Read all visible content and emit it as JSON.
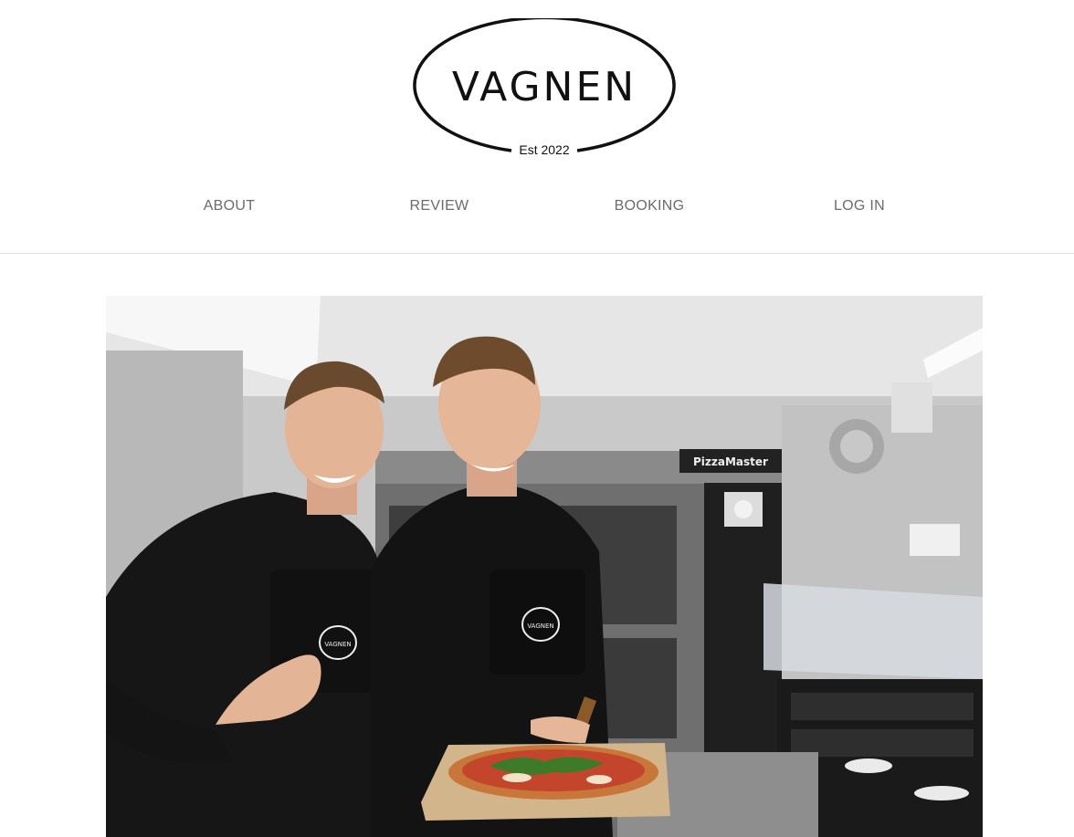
{
  "brand": {
    "name": "VAGNEN",
    "established": "Est 2022"
  },
  "nav": {
    "items": [
      {
        "label": "ABOUT"
      },
      {
        "label": "REVIEW"
      },
      {
        "label": "BOOKING"
      },
      {
        "label": "LOG IN"
      }
    ]
  },
  "hero": {
    "oven_brand": "PizzaMaster",
    "apron_logo": "VAGNEN"
  },
  "colors": {
    "text": "#111111",
    "nav": "#6b6b6b",
    "divider": "#e0e0e0"
  }
}
